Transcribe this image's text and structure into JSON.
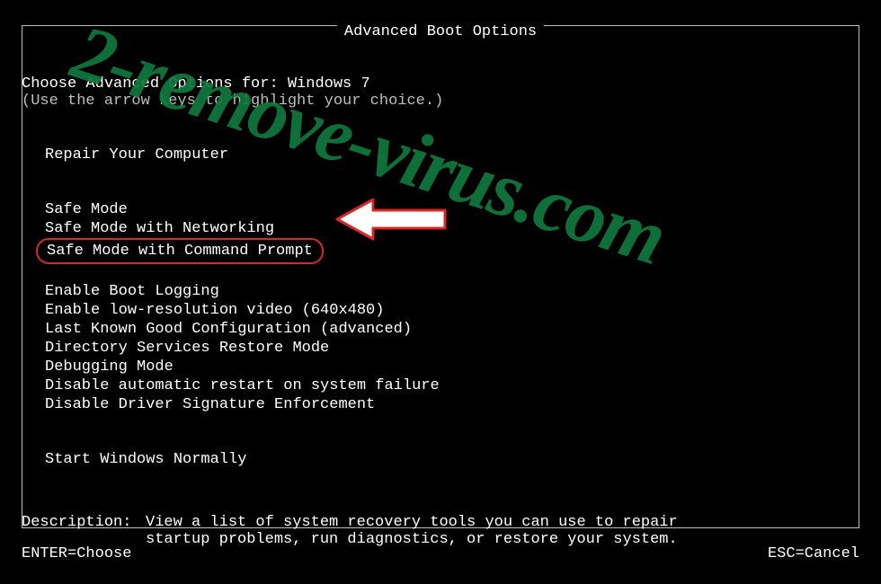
{
  "title": "Advanced Boot Options",
  "header": {
    "line1": "Choose Advanced Options for: Windows 7",
    "line2": "(Use the arrow keys to highlight your choice.)"
  },
  "groups": {
    "repair": "Repair Your Computer",
    "safe": [
      "Safe Mode",
      "Safe Mode with Networking",
      "Safe Mode with Command Prompt"
    ],
    "advanced": [
      "Enable Boot Logging",
      "Enable low-resolution video (640x480)",
      "Last Known Good Configuration (advanced)",
      "Directory Services Restore Mode",
      "Debugging Mode",
      "Disable automatic restart on system failure",
      "Disable Driver Signature Enforcement"
    ],
    "normal": "Start Windows Normally"
  },
  "description": {
    "label": "Description:",
    "text1": "View a list of system recovery tools you can use to repair",
    "text2": "startup problems, run diagnostics, or restore your system."
  },
  "footer": {
    "enter": "ENTER=Choose",
    "esc": "ESC=Cancel"
  },
  "watermark": "2-remove-virus.com"
}
